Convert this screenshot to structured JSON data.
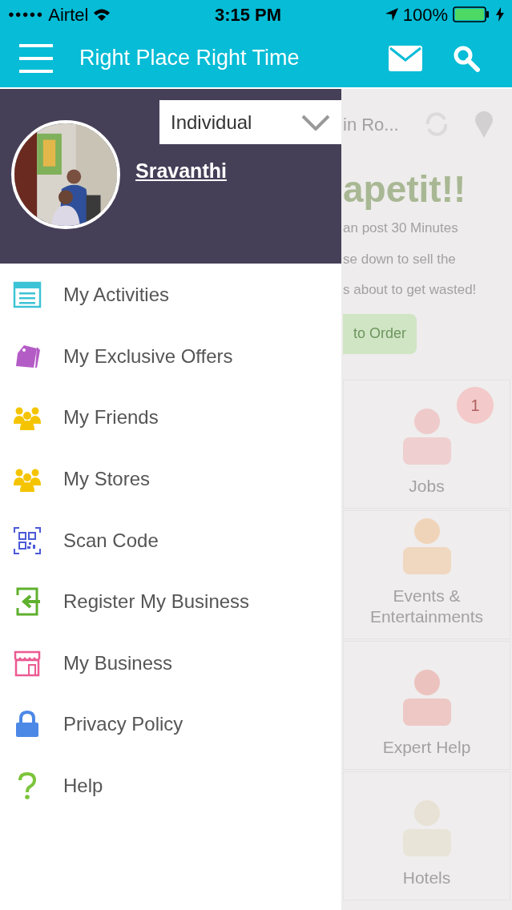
{
  "status_bar": {
    "signal_dots": "●●●●●",
    "carrier": "Airtel",
    "time": "3:15 PM",
    "battery": "100%"
  },
  "app_bar": {
    "title": "Right Place Right Time"
  },
  "drawer": {
    "account_type": "Individual",
    "user_name": "Sravanthi",
    "items": [
      {
        "label": "My Activities"
      },
      {
        "label": "My Exclusive Offers"
      },
      {
        "label": "My Friends"
      },
      {
        "label": "My Stores"
      },
      {
        "label": "Scan Code"
      },
      {
        "label": "Register My Business"
      },
      {
        "label": "My Business"
      },
      {
        "label": "Privacy Policy"
      },
      {
        "label": "Help"
      }
    ]
  },
  "background": {
    "location": "in Ro...",
    "banner_title": "apetit!!",
    "banner_lines": [
      "an post 30 Minutes",
      "se down to sell the",
      "s about to get wasted!"
    ],
    "banner_button": "to Order",
    "categories": [
      {
        "label": "Jobs",
        "badge": "1"
      },
      {
        "label": "Events & Entertainments"
      },
      {
        "label": "Expert Help"
      },
      {
        "label": "Hotels"
      }
    ]
  }
}
